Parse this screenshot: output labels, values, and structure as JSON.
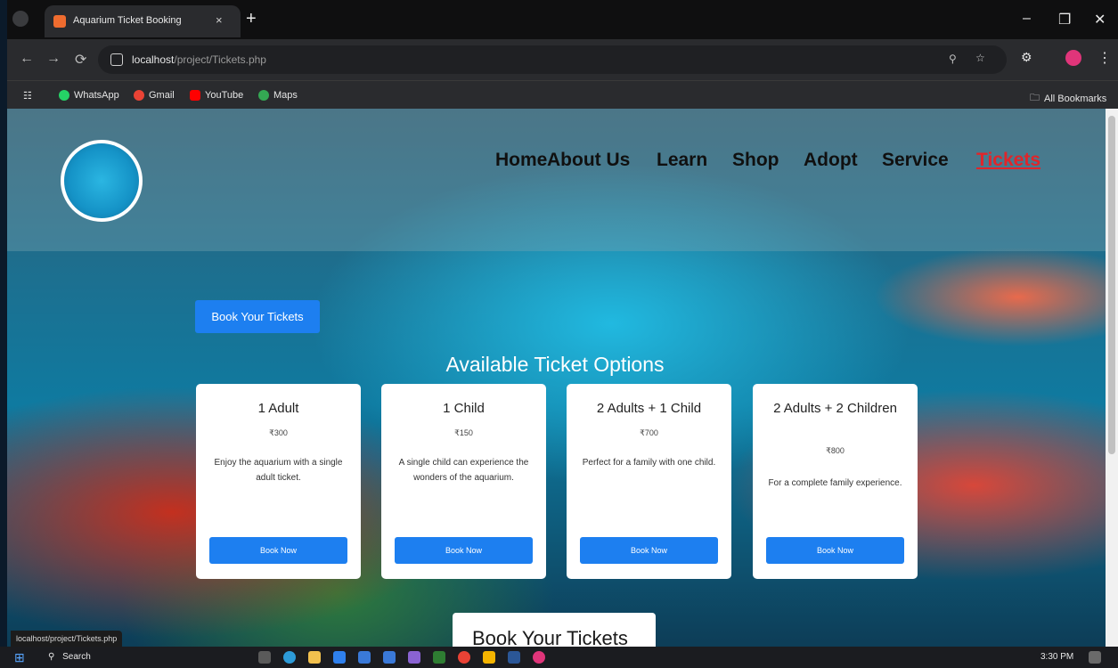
{
  "browser": {
    "tab_title": "Aquarium Ticket Booking",
    "tab_close": "×",
    "new_tab": "+",
    "url_host": "localhost",
    "url_path": "/project/Tickets.php",
    "bookmarks": [
      {
        "label": "WhatsApp",
        "color": "#25d366"
      },
      {
        "label": "Gmail",
        "color": "#ea4335"
      },
      {
        "label": "YouTube",
        "color": "#ff0000"
      },
      {
        "label": "Maps",
        "color": "#34a853"
      }
    ],
    "all_bookmarks": "All Bookmarks",
    "status_url": "localhost/project/Tickets.php"
  },
  "nav": {
    "items": [
      "Home",
      "About Us",
      "Learn",
      "Shop",
      "Adopt",
      "Service",
      "Tickets"
    ],
    "active": "Tickets"
  },
  "hero": {
    "book_button": "Book Your Tickets",
    "heading": "Available Ticket Options",
    "bottom_heading": "Book Your Tickets"
  },
  "tickets": [
    {
      "title": "1 Adult",
      "price": "₹300",
      "description": "Enjoy the aquarium with a single adult ticket.",
      "button": "Book Now"
    },
    {
      "title": "1 Child",
      "price": "₹150",
      "description": "A single child can experience the wonders of the aquarium.",
      "button": "Book Now"
    },
    {
      "title": "2 Adults + 1 Child",
      "price": "₹700",
      "description": "Perfect for a family with one child.",
      "button": "Book Now"
    },
    {
      "title": "2 Adults + 2 Children",
      "price": "₹800",
      "description": "For a complete family experience.",
      "button": "Book Now"
    }
  ],
  "taskbar": {
    "search_placeholder": "Search",
    "time": "3:30 PM"
  },
  "colors": {
    "accent": "#1d7ff0",
    "nav_active": "#e0252a"
  }
}
